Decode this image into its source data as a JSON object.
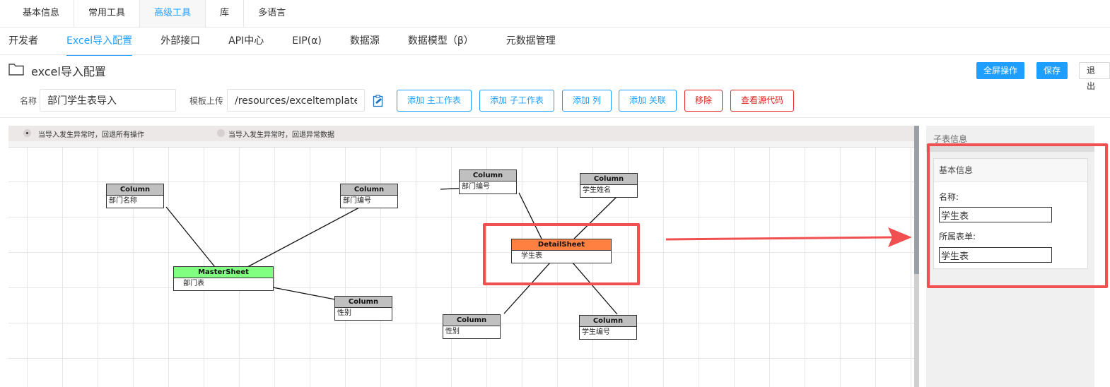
{
  "top_tabs": [
    "基本信息",
    "常用工具",
    "高级工具",
    "库",
    "多语言"
  ],
  "sub_tabs": [
    "开发者",
    "Excel导入配置",
    "外部接口",
    "API中心",
    "EIP(α)",
    "数据源",
    "数据模型（β）",
    "元数据管理"
  ],
  "title": "excel导入配置",
  "actions": {
    "fullscreen": "全屏操作",
    "save": "保存",
    "exit": "退出"
  },
  "form": {
    "name_label": "名称",
    "name_value": "部门学生表导入",
    "template_label": "模板上传",
    "template_value": "/resources/exceltemplate/部门"
  },
  "buttons": [
    "添加 主工作表",
    "添加 子工作表",
    "添加 列",
    "添加 关联",
    "移除",
    "查看源代码"
  ],
  "canvas": {
    "radio1": "当导入发生异常时，回退所有操作",
    "radio2": "当导入发生异常时，回退异常数据",
    "nodes": [
      {
        "title": "Column",
        "label": "部门名称"
      },
      {
        "title": "Column",
        "label": "部门编号"
      },
      {
        "title": "MasterSheet",
        "label": "部门表"
      },
      {
        "title": "Column",
        "label": "性别"
      },
      {
        "title": "Column",
        "label": "部门编号"
      },
      {
        "title": "Column",
        "label": "学生姓名"
      },
      {
        "title": "DetailSheet",
        "label": "学生表"
      },
      {
        "title": "Column",
        "label": "性别"
      },
      {
        "title": "Column",
        "label": "学生编号"
      }
    ]
  },
  "panel": {
    "title": "子表信息",
    "section": "基本信息",
    "name_label": "名称:",
    "name_value": "学生表",
    "form_label": "所属表单:",
    "form_value": "学生表"
  },
  "colors": {
    "accent": "#1e9fff",
    "danger": "#e02020",
    "master": "#80ff80",
    "detail": "#ff8040",
    "annotation": "#f05050"
  }
}
